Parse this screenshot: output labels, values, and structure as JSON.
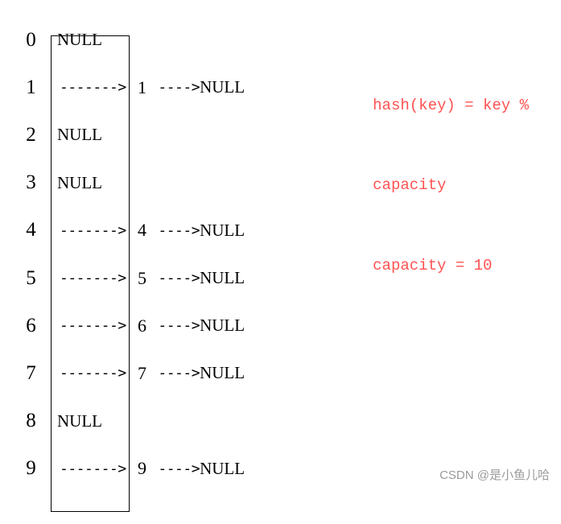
{
  "diagram": {
    "buckets": [
      {
        "index": "0",
        "type": "null",
        "content": "NULL"
      },
      {
        "index": "1",
        "type": "chain",
        "arrow1": "-------> ",
        "value": "1",
        "arrow2": " ---->",
        "tail": "NULL"
      },
      {
        "index": "2",
        "type": "null",
        "content": "NULL"
      },
      {
        "index": "3",
        "type": "null",
        "content": "NULL"
      },
      {
        "index": "4",
        "type": "chain",
        "arrow1": "-------> ",
        "value": "4",
        "arrow2": " ---->",
        "tail": "NULL"
      },
      {
        "index": "5",
        "type": "chain",
        "arrow1": "-------> ",
        "value": "5",
        "arrow2": " ---->",
        "tail": "NULL"
      },
      {
        "index": "6",
        "type": "chain",
        "arrow1": "-------> ",
        "value": "6",
        "arrow2": " ---->",
        "tail": "NULL"
      },
      {
        "index": "7",
        "type": "chain",
        "arrow1": "-------> ",
        "value": "7",
        "arrow2": " ---->",
        "tail": "NULL"
      },
      {
        "index": "8",
        "type": "null",
        "content": "NULL"
      },
      {
        "index": "9",
        "type": "chain",
        "arrow1": "-------> ",
        "value": "9",
        "arrow2": " ---->",
        "tail": "NULL"
      }
    ]
  },
  "legend": {
    "line1": "hash(key) = key %",
    "line2": "capacity",
    "line3": "capacity = 10"
  },
  "watermark": "CSDN @是小鱼儿哈",
  "chart_data": {
    "type": "table",
    "description": "Hash table buckets using separate chaining",
    "capacity": 10,
    "hash_function": "hash(key) = key % capacity",
    "buckets": [
      {
        "index": 0,
        "chain": null
      },
      {
        "index": 1,
        "chain": [
          1
        ]
      },
      {
        "index": 2,
        "chain": null
      },
      {
        "index": 3,
        "chain": null
      },
      {
        "index": 4,
        "chain": [
          4
        ]
      },
      {
        "index": 5,
        "chain": [
          5
        ]
      },
      {
        "index": 6,
        "chain": [
          6
        ]
      },
      {
        "index": 7,
        "chain": [
          7
        ]
      },
      {
        "index": 8,
        "chain": null
      },
      {
        "index": 9,
        "chain": [
          9
        ]
      }
    ]
  }
}
